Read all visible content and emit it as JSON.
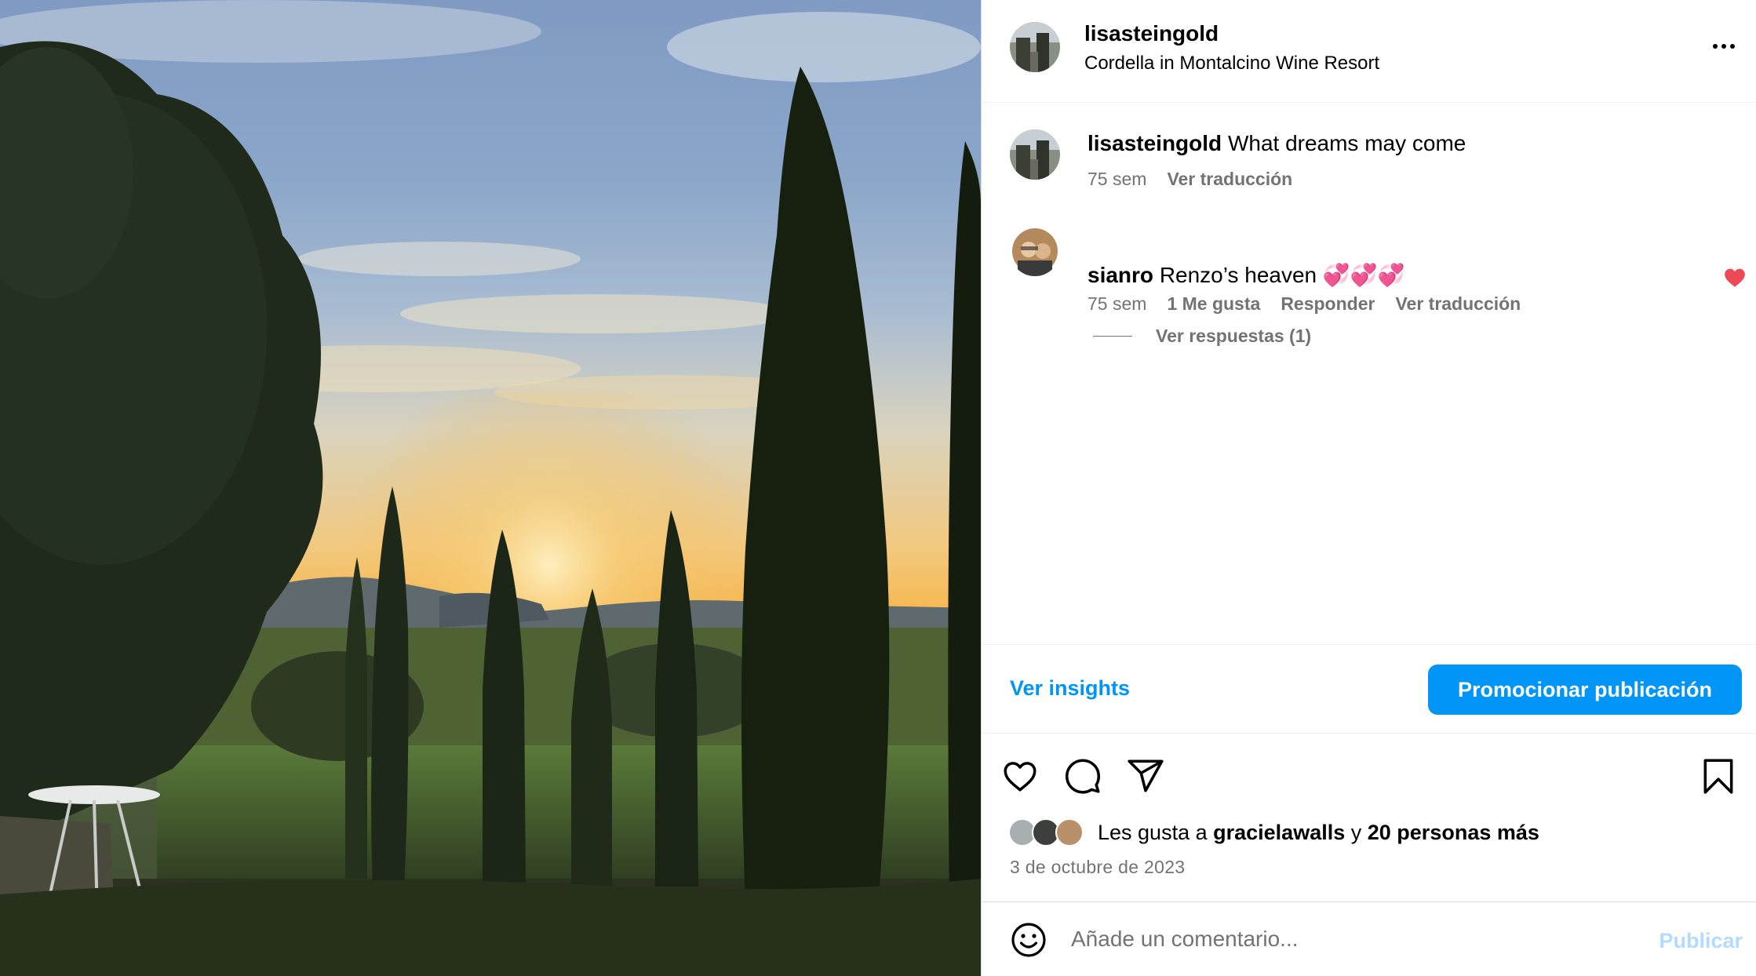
{
  "post": {
    "username": "lisasteingold",
    "location": "Cordella in Montalcino Wine Resort",
    "more_icon": "more-horizontal-icon"
  },
  "caption": {
    "username": "lisasteingold",
    "text": "What dreams may come",
    "time": "75 sem",
    "translate": "Ver traducción"
  },
  "comment": {
    "username": "sianro",
    "text": "Renzo’s heaven 💞💞💞",
    "time": "75 sem",
    "likes": "1 Me gusta",
    "reply": "Responder",
    "translate": "Ver traducción",
    "liked_by_author": true,
    "view_replies": "Ver respuestas (1)"
  },
  "insights": {
    "link": "Ver insights",
    "promote": "Promocionar publicación"
  },
  "actions": {
    "icons": [
      "heart-outline-icon",
      "comment-bubble-icon",
      "share-paper-plane-icon",
      "bookmark-icon"
    ]
  },
  "likes": {
    "prefix": "Les gusta a",
    "user": "gracielawalls",
    "connector": "y",
    "others": "20 personas más"
  },
  "date": "3 de octubre de 2023",
  "add_comment": {
    "placeholder": "Añade un comentario...",
    "publish": "Publicar"
  },
  "colors": {
    "accent": "#0095f6",
    "muted": "#737373",
    "heart": "#ed4956",
    "publish_disabled": "#b3dbff"
  }
}
